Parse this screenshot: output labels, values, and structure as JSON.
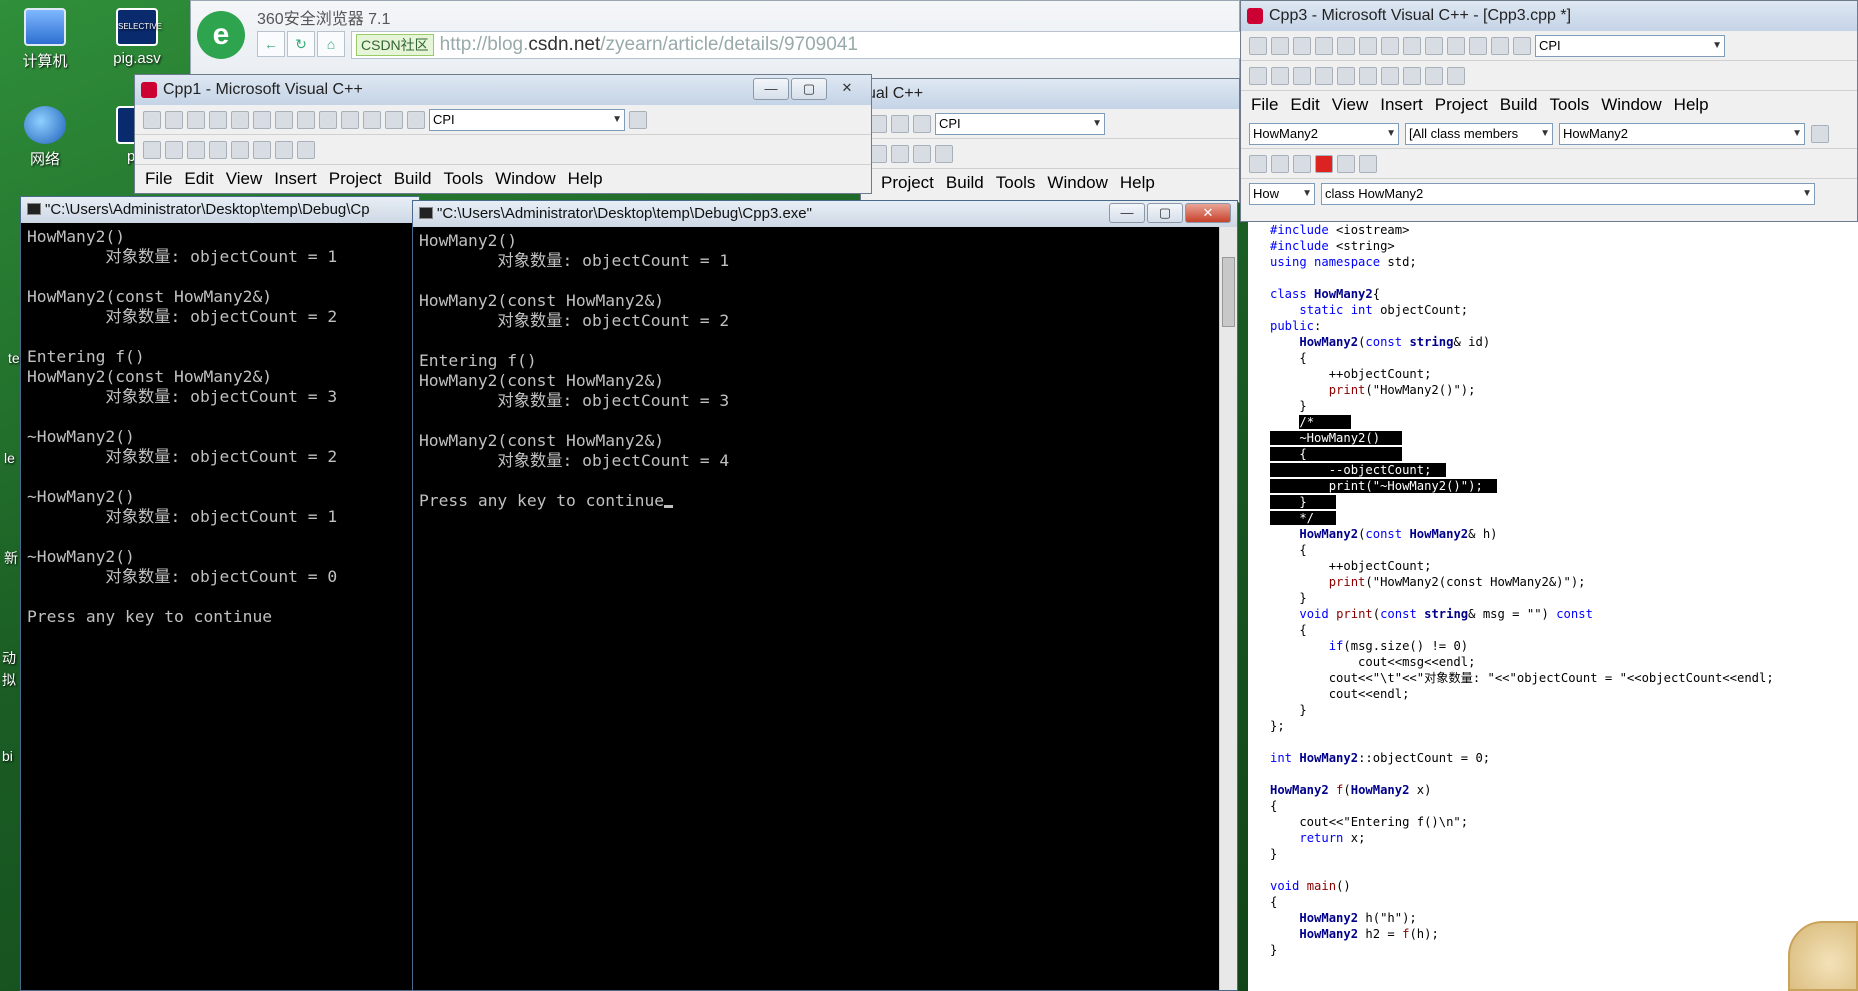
{
  "desktop": {
    "icons": [
      {
        "label": "计算机",
        "icon": "computer-icon"
      },
      {
        "label": "pig.asv",
        "icon": "pig-icon"
      },
      {
        "label": "网络",
        "icon": "network-icon"
      },
      {
        "label": "pig",
        "icon": "pig-icon"
      }
    ],
    "edge_fragments": [
      "te",
      "le",
      "新",
      "动",
      "拟",
      "bi"
    ]
  },
  "browser": {
    "title": "360安全浏览器 7.1",
    "logo": "e",
    "address_chip": "CSDN社区",
    "address_prefix": "http://blog.",
    "address_domain": "csdn.net",
    "address_path": "/zyearn/article/details/9709041"
  },
  "cpp1": {
    "title": "Cpp1 - Microsoft Visual C++",
    "config_combo": "CPI",
    "menu": [
      "File",
      "Edit",
      "View",
      "Insert",
      "Project",
      "Build",
      "Tools",
      "Window",
      "Help"
    ],
    "hidden_title": "ual C++",
    "hidden_config_combo": "CPI",
    "hidden_menu": [
      "Project",
      "Build",
      "Tools",
      "Window",
      "Help"
    ]
  },
  "cpp3": {
    "title": "Cpp3 - Microsoft Visual C++ - [Cpp3.cpp *]",
    "config_combo": "CPI",
    "menu": [
      "File",
      "Edit",
      "View",
      "Insert",
      "Project",
      "Build",
      "Tools",
      "Window",
      "Help"
    ],
    "class_combo": "HowMany2",
    "members_combo": "[All class members",
    "function_combo": "HowMany2",
    "scope_combo": "How",
    "class_view": "class HowMany2"
  },
  "console1": {
    "title": "\"C:\\Users\\Administrator\\Desktop\\temp\\Debug\\Cp",
    "output": "HowMany2()\n        对象数量: objectCount = 1\n\nHowMany2(const HowMany2&)\n        对象数量: objectCount = 2\n\nEntering f()\nHowMany2(const HowMany2&)\n        对象数量: objectCount = 3\n\n~HowMany2()\n        对象数量: objectCount = 2\n\n~HowMany2()\n        对象数量: objectCount = 1\n\n~HowMany2()\n        对象数量: objectCount = 0\n\nPress any key to continue"
  },
  "console2": {
    "title": "\"C:\\Users\\Administrator\\Desktop\\temp\\Debug\\Cpp3.exe\"",
    "output": "HowMany2()\n        对象数量: objectCount = 1\n\nHowMany2(const HowMany2&)\n        对象数量: objectCount = 2\n\nEntering f()\nHowMany2(const HowMany2&)\n        对象数量: objectCount = 3\n\nHowMany2(const HowMany2&)\n        对象数量: objectCount = 4\n\nPress any key to continue"
  },
  "window_controls": {
    "minimize": "—",
    "maximize": "▢",
    "close": "✕"
  }
}
